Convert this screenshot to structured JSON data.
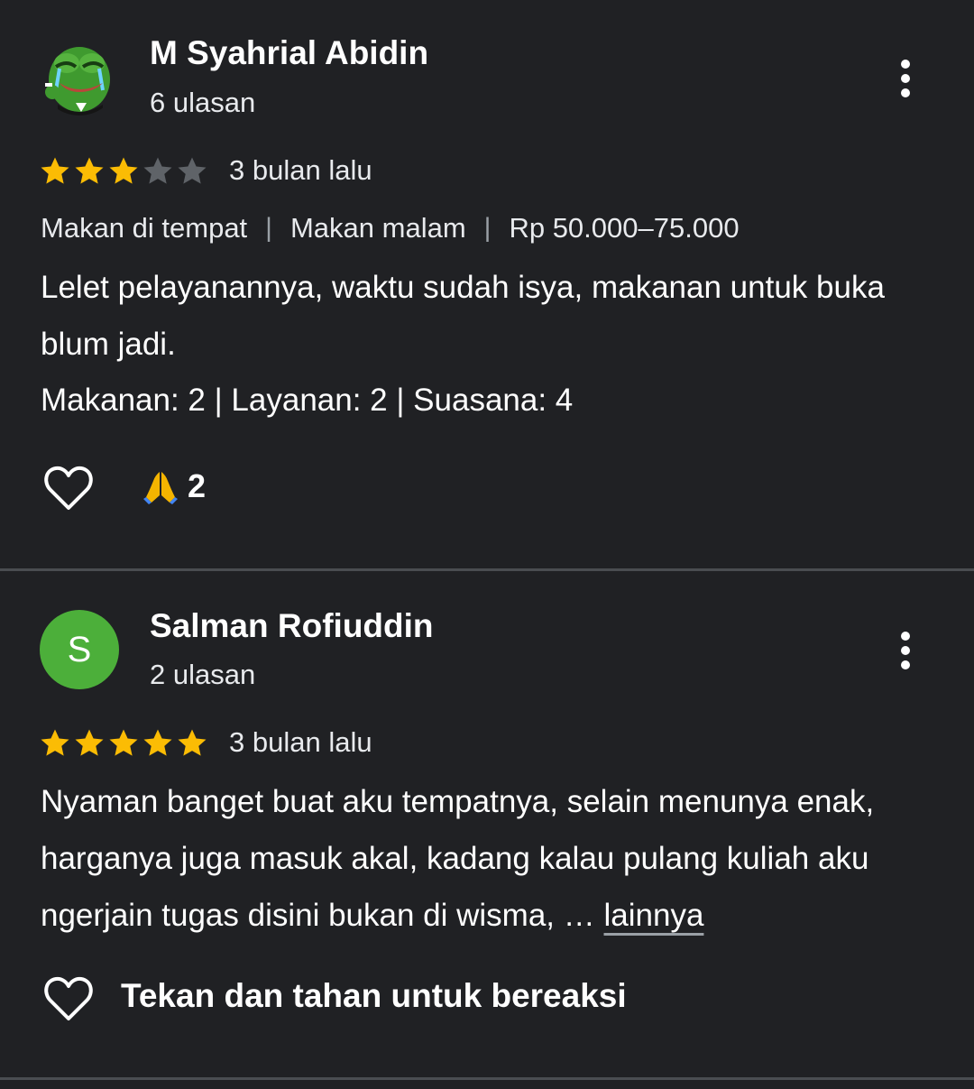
{
  "reviews": [
    {
      "author": "M Syahrial Abidin",
      "review_count": "6 ulasan",
      "rating": 3,
      "date": "3 bulan lalu",
      "tags": [
        "Makan di tempat",
        "Makan malam",
        "Rp 50.000–75.000"
      ],
      "text": "Lelet pelayanannya, waktu sudah isya, makanan untuk buka blum jadi.",
      "ratings_line": "Makanan: 2 | Layanan: 2 | Suasana: 4",
      "reaction": {
        "icon": "folded-hands-emoji",
        "count": "2"
      }
    },
    {
      "author": "Salman Rofiuddin",
      "avatar_letter": "S",
      "review_count": "2 ulasan",
      "rating": 5,
      "date": "3 bulan lalu",
      "text": "Nyaman banget buat aku tempatnya, selain menunya enak, harganya juga masuk akal, kadang kalau pulang kuliah aku ngerjain tugas disini bukan di wisma, …",
      "more_label": "lainnya",
      "react_hint": "Tekan dan tahan untuk bereaksi"
    }
  ],
  "colors": {
    "background": "#202124",
    "star_filled": "#fbbc04",
    "star_empty": "#5f6368",
    "avatar_green": "#4caf3a",
    "divider": "#4a4d51"
  },
  "icons": [
    "more-vert-icon",
    "heart-outline-icon",
    "star-icon"
  ]
}
